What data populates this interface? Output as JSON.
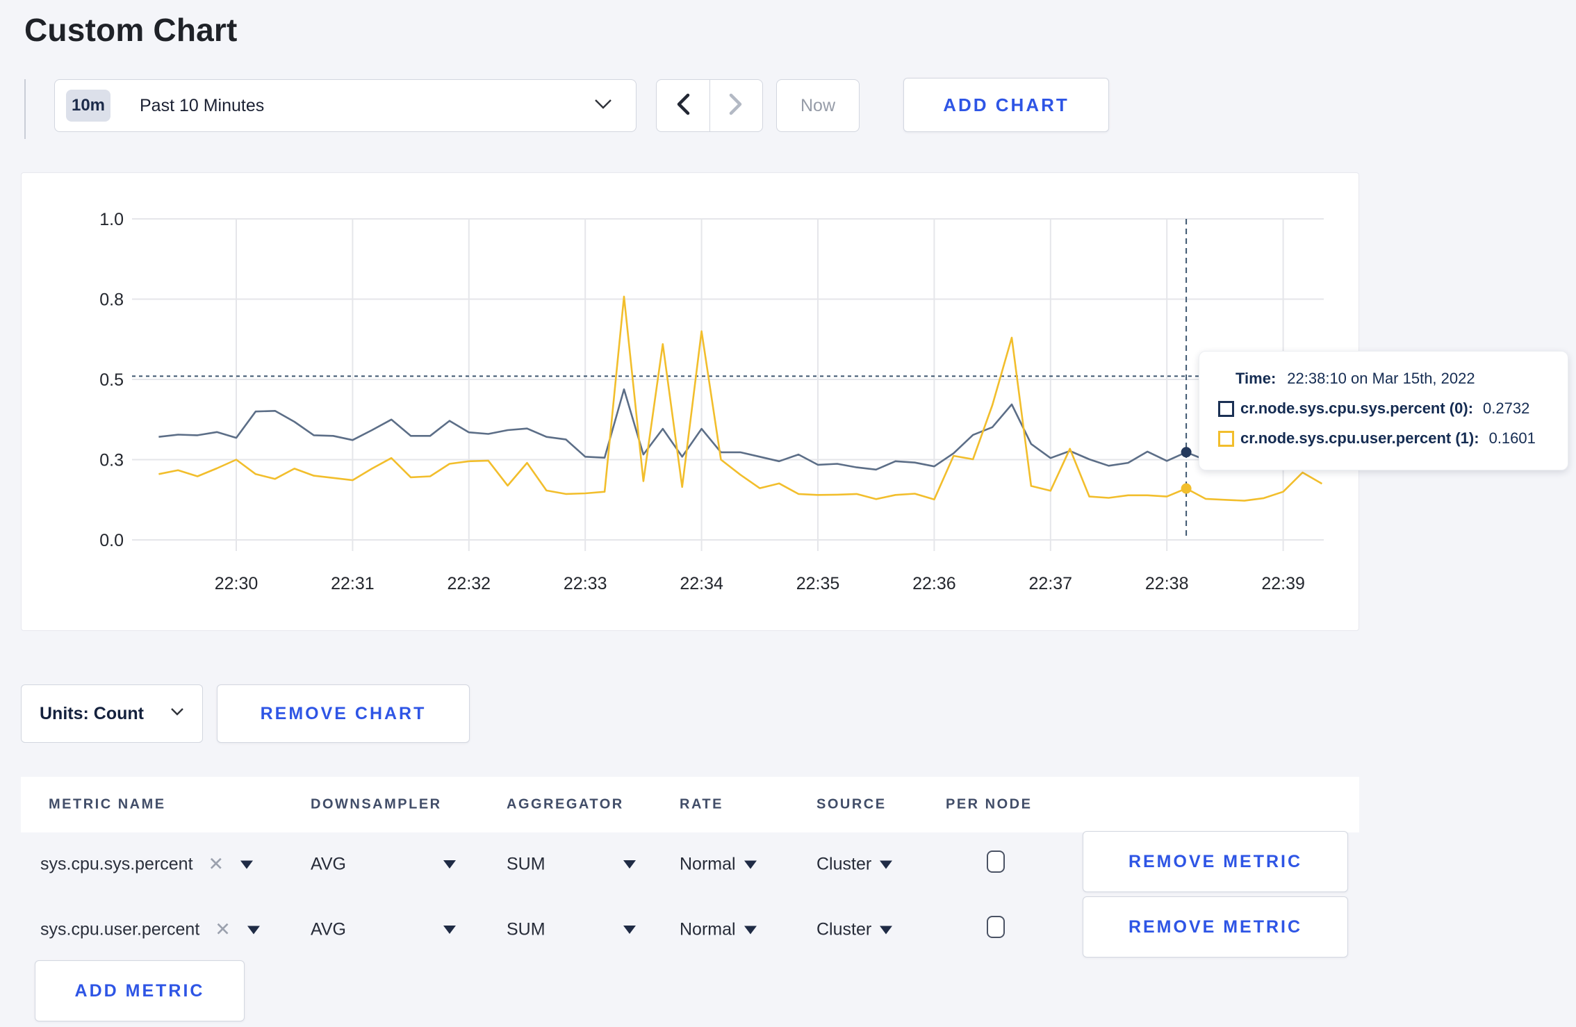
{
  "page": {
    "title": "Custom Chart"
  },
  "toolbar": {
    "range_badge": "10m",
    "range_label": "Past 10 Minutes",
    "prev_icon": "chevron-left",
    "next_icon": "chevron-right",
    "now_label": "Now",
    "add_chart_label": "ADD CHART"
  },
  "chart_data": {
    "type": "line",
    "title": "",
    "xlabel": "",
    "ylabel": "",
    "ylim": [
      0,
      1
    ],
    "grid": true,
    "legend_position": "tooltip",
    "x_start_time": "22:29:20",
    "x_step_seconds": 10,
    "x_tick_labels": [
      "22:30",
      "22:31",
      "22:32",
      "22:33",
      "22:34",
      "22:35",
      "22:36",
      "22:37",
      "22:38",
      "22:39"
    ],
    "y_ticks": [
      {
        "value": 0,
        "label": "0.0"
      },
      {
        "value": 0.25,
        "label": "0.3"
      },
      {
        "value": 0.5,
        "label": "0.5"
      },
      {
        "value": 0.75,
        "label": "0.8"
      },
      {
        "value": 1,
        "label": "1.0"
      }
    ],
    "series": [
      {
        "name": "cr.node.sys.cpu.sys.percent (0)",
        "color": "#5c6e87",
        "marker_color": "#24395c",
        "values": [
          0.321,
          0.328,
          0.326,
          0.336,
          0.318,
          0.4,
          0.402,
          0.368,
          0.326,
          0.324,
          0.311,
          0.342,
          0.375,
          0.324,
          0.324,
          0.371,
          0.335,
          0.33,
          0.342,
          0.347,
          0.321,
          0.313,
          0.259,
          0.256,
          0.469,
          0.266,
          0.346,
          0.259,
          0.346,
          0.273,
          0.273,
          0.259,
          0.245,
          0.266,
          0.234,
          0.237,
          0.226,
          0.219,
          0.245,
          0.241,
          0.229,
          0.27,
          0.327,
          0.351,
          0.422,
          0.299,
          0.255,
          0.277,
          0.251,
          0.231,
          0.24,
          0.275,
          0.246,
          0.2732,
          0.249,
          0.255,
          0.26,
          0.252,
          0.258,
          0.3,
          0.285
        ]
      },
      {
        "name": "cr.node.sys.cpu.user.percent (1)",
        "color": "#f2be2c",
        "marker_color": "#f2be2c",
        "values": [
          0.205,
          0.217,
          0.198,
          0.223,
          0.25,
          0.205,
          0.19,
          0.222,
          0.2,
          0.193,
          0.186,
          0.222,
          0.255,
          0.195,
          0.198,
          0.237,
          0.245,
          0.247,
          0.169,
          0.24,
          0.154,
          0.143,
          0.145,
          0.15,
          0.758,
          0.183,
          0.61,
          0.165,
          0.65,
          0.25,
          0.203,
          0.161,
          0.176,
          0.143,
          0.14,
          0.141,
          0.143,
          0.127,
          0.14,
          0.144,
          0.126,
          0.262,
          0.251,
          0.42,
          0.63,
          0.168,
          0.153,
          0.284,
          0.135,
          0.131,
          0.139,
          0.139,
          0.135,
          0.1601,
          0.128,
          0.125,
          0.122,
          0.13,
          0.15,
          0.21,
          0.175
        ]
      }
    ],
    "crosshair": {
      "index": 53,
      "time": "22:38:10",
      "hover_line_value": 0.51
    }
  },
  "tooltip": {
    "time_label": "Time:",
    "time_value": "22:38:10 on Mar 15th, 2022",
    "rows": [
      {
        "label": "cr.node.sys.cpu.sys.percent (0):",
        "value": "0.2732",
        "color": "#1b3054"
      },
      {
        "label": "cr.node.sys.cpu.user.percent (1):",
        "value": "0.1601",
        "color": "#f2be2c"
      }
    ]
  },
  "chart_footer": {
    "units_label": "Units: Count",
    "remove_chart_label": "REMOVE CHART"
  },
  "metrics_table": {
    "headers": [
      "METRIC NAME",
      "DOWNSAMPLER",
      "AGGREGATOR",
      "RATE",
      "SOURCE",
      "PER NODE"
    ],
    "rows": [
      {
        "metric_name": "sys.cpu.sys.percent",
        "downsampler": "AVG",
        "aggregator": "SUM",
        "rate": "Normal",
        "source": "Cluster",
        "per_node_checked": false,
        "remove_label": "REMOVE METRIC"
      },
      {
        "metric_name": "sys.cpu.user.percent",
        "downsampler": "AVG",
        "aggregator": "SUM",
        "rate": "Normal",
        "source": "Cluster",
        "per_node_checked": false,
        "remove_label": "REMOVE METRIC"
      }
    ],
    "add_metric_label": "ADD METRIC"
  },
  "colors": {
    "accent_blue": "#2e55e5",
    "page_bg": "#f4f5f9",
    "gridline": "#e5e6ea",
    "crosshair": "#3c556f",
    "navy_text": "#152c52"
  }
}
